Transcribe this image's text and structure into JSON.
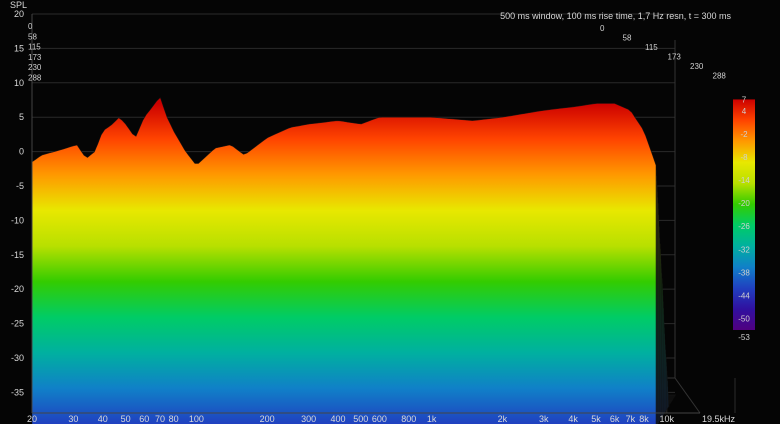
{
  "chart_data": {
    "type": "waterfall",
    "title": "500 ms window, 100 ms rise time,  1,7 Hz resn, t = 300 ms",
    "ylabel": "SPL",
    "ylim": [
      -38,
      20
    ],
    "y_ticks": [
      20,
      15,
      10,
      5,
      0,
      -5,
      -10,
      -15,
      -20,
      -25,
      -30,
      -35
    ],
    "x_scale": "log",
    "xlim": [
      20,
      19500
    ],
    "x_ticks": [
      {
        "value": 20,
        "label": "20"
      },
      {
        "value": 30,
        "label": "30"
      },
      {
        "value": 40,
        "label": "40"
      },
      {
        "value": 50,
        "label": "50"
      },
      {
        "value": 60,
        "label": "60"
      },
      {
        "value": 70,
        "label": "70"
      },
      {
        "value": 80,
        "label": "80"
      },
      {
        "value": 100,
        "label": "100"
      },
      {
        "value": 200,
        "label": "200"
      },
      {
        "value": 300,
        "label": "300"
      },
      {
        "value": 400,
        "label": "400"
      },
      {
        "value": 500,
        "label": "500"
      },
      {
        "value": 600,
        "label": "600"
      },
      {
        "value": 800,
        "label": "800"
      },
      {
        "value": 1000,
        "label": "1k"
      },
      {
        "value": 2000,
        "label": "2k"
      },
      {
        "value": 3000,
        "label": "3k"
      },
      {
        "value": 4000,
        "label": "4k"
      },
      {
        "value": 5000,
        "label": "5k"
      },
      {
        "value": 6000,
        "label": "6k"
      },
      {
        "value": 7000,
        "label": "7k"
      },
      {
        "value": 8000,
        "label": "8k"
      },
      {
        "value": 10000,
        "label": "10k"
      },
      {
        "value": 19500,
        "label": "19.5kHz"
      }
    ],
    "time_ticks_left": [
      "0",
      "58",
      "115",
      "173",
      "230",
      "288"
    ],
    "time_ticks_right": [
      "0",
      "58",
      "115",
      "173",
      "230",
      "288"
    ],
    "time_range_ms": [
      0,
      300
    ],
    "colorbar_ticks": [
      7,
      4,
      -2,
      -8,
      -14,
      -20,
      -26,
      -32,
      -38,
      -44,
      -50,
      -53
    ],
    "colorbar_range": [
      -53,
      7
    ],
    "colorbar_colors": [
      "#cc0000",
      "#ff4400",
      "#ff9900",
      "#e8e800",
      "#b8e000",
      "#33cc00",
      "#00cc66",
      "#00b0a0",
      "#1080c8",
      "#2040c0",
      "#3010a0",
      "#500080"
    ],
    "front_curve": [
      {
        "f": 20,
        "spl": -1.5
      },
      {
        "f": 22,
        "spl": -0.5
      },
      {
        "f": 25,
        "spl": 0.0
      },
      {
        "f": 28,
        "spl": 0.5
      },
      {
        "f": 31,
        "spl": 1.0
      },
      {
        "f": 34,
        "spl": -1.0
      },
      {
        "f": 37,
        "spl": 0.0
      },
      {
        "f": 40,
        "spl": 3.0
      },
      {
        "f": 44,
        "spl": 4.0
      },
      {
        "f": 47,
        "spl": 5.0
      },
      {
        "f": 50,
        "spl": 4.0
      },
      {
        "f": 55,
        "spl": 2.0
      },
      {
        "f": 60,
        "spl": 5.0
      },
      {
        "f": 65,
        "spl": 6.5
      },
      {
        "f": 70,
        "spl": 8.0
      },
      {
        "f": 75,
        "spl": 5.0
      },
      {
        "f": 80,
        "spl": 3.0
      },
      {
        "f": 90,
        "spl": 0.0
      },
      {
        "f": 100,
        "spl": -2.0
      },
      {
        "f": 120,
        "spl": 0.5
      },
      {
        "f": 140,
        "spl": 1.0
      },
      {
        "f": 160,
        "spl": -0.5
      },
      {
        "f": 200,
        "spl": 2.0
      },
      {
        "f": 250,
        "spl": 3.5
      },
      {
        "f": 300,
        "spl": 4.0
      },
      {
        "f": 400,
        "spl": 4.5
      },
      {
        "f": 500,
        "spl": 4.0
      },
      {
        "f": 600,
        "spl": 5.0
      },
      {
        "f": 800,
        "spl": 5.0
      },
      {
        "f": 1000,
        "spl": 5.0
      },
      {
        "f": 1500,
        "spl": 4.5
      },
      {
        "f": 2000,
        "spl": 5.0
      },
      {
        "f": 3000,
        "spl": 6.0
      },
      {
        "f": 4000,
        "spl": 6.5
      },
      {
        "f": 5000,
        "spl": 7.0
      },
      {
        "f": 6000,
        "spl": 7.0
      },
      {
        "f": 7000,
        "spl": 6.0
      },
      {
        "f": 8000,
        "spl": 3.0
      },
      {
        "f": 9000,
        "spl": -2.0
      }
    ]
  }
}
